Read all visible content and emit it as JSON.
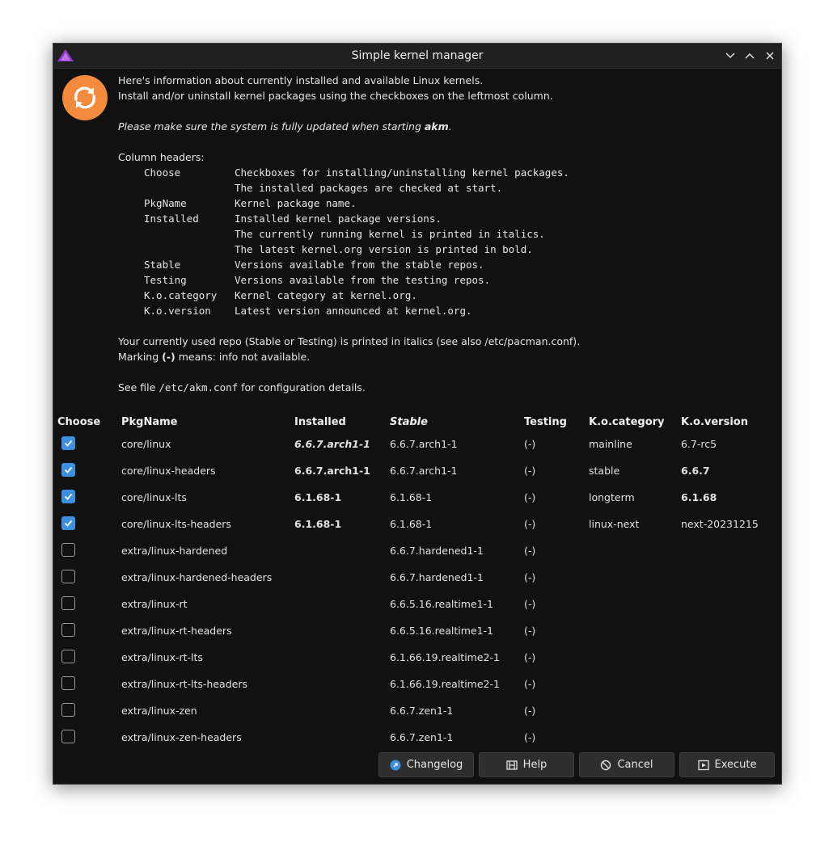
{
  "window": {
    "title": "Simple kernel manager",
    "icon": "app-logo-triangle",
    "controls": [
      "minimize-chevron",
      "maximize-chevron",
      "close-x"
    ]
  },
  "info": {
    "icon": "refresh-circle-icon",
    "line1": "Here's information about currently installed and available Linux kernels.",
    "line2": "Install and/or uninstall kernel packages using the checkboxes on the leftmost column.",
    "update_note_prefix": "Please make sure the system is fully updated when starting ",
    "update_note_app": "akm",
    "update_note_suffix": ".",
    "column_headers_title": "Column headers:",
    "column_descriptions": [
      {
        "name": "Choose",
        "lines": [
          "Checkboxes for installing/uninstalling kernel packages.",
          "The installed packages are checked at start."
        ]
      },
      {
        "name": "PkgName",
        "lines": [
          "Kernel package name."
        ]
      },
      {
        "name": "Installed",
        "lines": [
          "Installed kernel package versions.",
          "The currently running kernel is printed in italics.",
          "The latest kernel.org version is printed in bold."
        ]
      },
      {
        "name": "Stable",
        "lines": [
          "Versions available from the stable repos."
        ]
      },
      {
        "name": "Testing",
        "lines": [
          "Versions available from the testing repos."
        ]
      },
      {
        "name": "K.o.category",
        "lines": [
          "Kernel category at kernel.org."
        ]
      },
      {
        "name": "K.o.version",
        "lines": [
          "Latest version announced at kernel.org."
        ]
      }
    ],
    "repo_note": "Your currently used repo (Stable or Testing) is printed in italics (see also /etc/pacman.conf).",
    "marking_prefix": "Marking ",
    "marking_symbol": "(-)",
    "marking_suffix": " means: info not available.",
    "config_prefix": "See file ",
    "config_file": "/etc/akm.conf",
    "config_suffix": " for configuration details."
  },
  "table": {
    "headers": {
      "choose": "Choose",
      "pkgname": "PkgName",
      "installed": "Installed",
      "stable": "Stable",
      "testing": "Testing",
      "ko_category": "K.o.category",
      "ko_version": "K.o.version"
    },
    "rows": [
      {
        "checked": true,
        "pkgname": "core/linux",
        "installed": "6.6.7.arch1-1",
        "installed_style": "bold-italic",
        "stable": "6.6.7.arch1-1",
        "testing": "(-)",
        "ko_category": "mainline",
        "ko_version": "6.7-rc5",
        "ko_version_bold": false
      },
      {
        "checked": true,
        "pkgname": "core/linux-headers",
        "installed": "6.6.7.arch1-1",
        "installed_style": "bold",
        "stable": "6.6.7.arch1-1",
        "testing": "(-)",
        "ko_category": "stable",
        "ko_version": "6.6.7",
        "ko_version_bold": true
      },
      {
        "checked": true,
        "pkgname": "core/linux-lts",
        "installed": "6.1.68-1",
        "installed_style": "bold",
        "stable": "6.1.68-1",
        "testing": "(-)",
        "ko_category": "longterm",
        "ko_version": "6.1.68",
        "ko_version_bold": true
      },
      {
        "checked": true,
        "pkgname": "core/linux-lts-headers",
        "installed": "6.1.68-1",
        "installed_style": "bold",
        "stable": "6.1.68-1",
        "testing": "(-)",
        "ko_category": "linux-next",
        "ko_version": "next-20231215",
        "ko_version_bold": false
      },
      {
        "checked": false,
        "pkgname": "extra/linux-hardened",
        "installed": "",
        "installed_style": "normal",
        "stable": "6.6.7.hardened1-1",
        "testing": "(-)",
        "ko_category": "",
        "ko_version": "",
        "ko_version_bold": false
      },
      {
        "checked": false,
        "pkgname": "extra/linux-hardened-headers",
        "installed": "",
        "installed_style": "normal",
        "stable": "6.6.7.hardened1-1",
        "testing": "(-)",
        "ko_category": "",
        "ko_version": "",
        "ko_version_bold": false
      },
      {
        "checked": false,
        "pkgname": "extra/linux-rt",
        "installed": "",
        "installed_style": "normal",
        "stable": "6.6.5.16.realtime1-1",
        "testing": "(-)",
        "ko_category": "",
        "ko_version": "",
        "ko_version_bold": false
      },
      {
        "checked": false,
        "pkgname": "extra/linux-rt-headers",
        "installed": "",
        "installed_style": "normal",
        "stable": "6.6.5.16.realtime1-1",
        "testing": "(-)",
        "ko_category": "",
        "ko_version": "",
        "ko_version_bold": false
      },
      {
        "checked": false,
        "pkgname": "extra/linux-rt-lts",
        "installed": "",
        "installed_style": "normal",
        "stable": "6.1.66.19.realtime2-1",
        "testing": "(-)",
        "ko_category": "",
        "ko_version": "",
        "ko_version_bold": false
      },
      {
        "checked": false,
        "pkgname": "extra/linux-rt-lts-headers",
        "installed": "",
        "installed_style": "normal",
        "stable": "6.1.66.19.realtime2-1",
        "testing": "(-)",
        "ko_category": "",
        "ko_version": "",
        "ko_version_bold": false
      },
      {
        "checked": false,
        "pkgname": "extra/linux-zen",
        "installed": "",
        "installed_style": "normal",
        "stable": "6.6.7.zen1-1",
        "testing": "(-)",
        "ko_category": "",
        "ko_version": "",
        "ko_version_bold": false
      },
      {
        "checked": false,
        "pkgname": "extra/linux-zen-headers",
        "installed": "",
        "installed_style": "normal",
        "stable": "6.6.7.zen1-1",
        "testing": "(-)",
        "ko_category": "",
        "ko_version": "",
        "ko_version_bold": false
      }
    ]
  },
  "buttons": {
    "changelog": "Changelog",
    "help": "Help",
    "cancel": "Cancel",
    "execute": "Execute"
  },
  "colors": {
    "background": "#111111",
    "titlebar": "#202020",
    "accent_checkbox": "#3d8fe0",
    "info_icon": "#f48a3c",
    "button_bg": "#2e2e2e"
  }
}
